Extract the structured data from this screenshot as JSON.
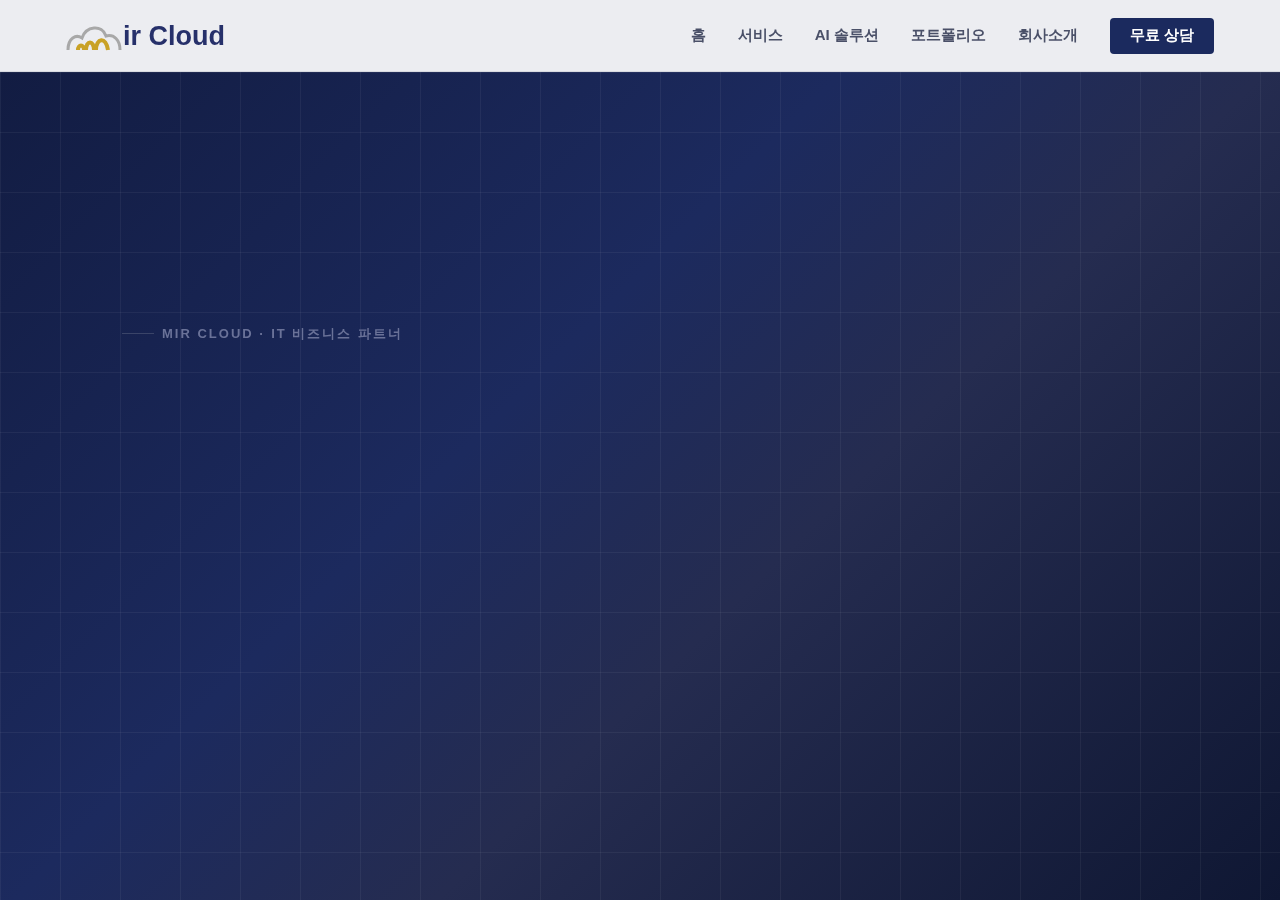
{
  "header": {
    "logo_text": "ir Cloud",
    "nav": [
      {
        "label": "홈"
      },
      {
        "label": "서비스"
      },
      {
        "label": "AI 솔루션"
      },
      {
        "label": "포트폴리오"
      },
      {
        "label": "회사소개"
      }
    ],
    "cta": "무료 상담"
  },
  "hero": {
    "eyebrow": "MIR CLOUD · IT 비즈니스 파트너"
  }
}
